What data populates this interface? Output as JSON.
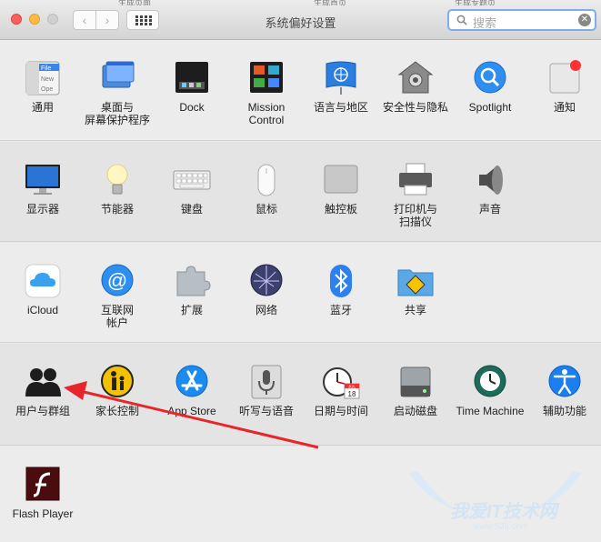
{
  "window": {
    "title": "系统偏好设置",
    "nav_back": "‹",
    "nav_forward": "›",
    "bg_tabs": [
      "生成页面",
      "生成首页",
      "生成专题页"
    ]
  },
  "search": {
    "placeholder": "搜索",
    "clear": "✕"
  },
  "rows": [
    [
      {
        "label": "通用",
        "icon": "general-icon"
      },
      {
        "label": "桌面与\n屏幕保护程序",
        "icon": "desktop-screensaver-icon"
      },
      {
        "label": "Dock",
        "icon": "dock-icon"
      },
      {
        "label": "Mission\nControl",
        "icon": "mission-control-icon"
      },
      {
        "label": "语言与地区",
        "icon": "language-region-icon"
      },
      {
        "label": "安全性与隐私",
        "icon": "security-privacy-icon"
      },
      {
        "label": "Spotlight",
        "icon": "spotlight-icon"
      },
      {
        "label": "通知",
        "icon": "notifications-icon"
      }
    ],
    [
      {
        "label": "显示器",
        "icon": "displays-icon"
      },
      {
        "label": "节能器",
        "icon": "energy-saver-icon"
      },
      {
        "label": "键盘",
        "icon": "keyboard-icon"
      },
      {
        "label": "鼠标",
        "icon": "mouse-icon"
      },
      {
        "label": "触控板",
        "icon": "trackpad-icon"
      },
      {
        "label": "打印机与\n扫描仪",
        "icon": "printer-icon"
      },
      {
        "label": "声音",
        "icon": "sound-icon"
      }
    ],
    [
      {
        "label": "iCloud",
        "icon": "icloud-icon"
      },
      {
        "label": "互联网\n帐户",
        "icon": "internet-accounts-icon"
      },
      {
        "label": "扩展",
        "icon": "extensions-icon"
      },
      {
        "label": "网络",
        "icon": "network-icon"
      },
      {
        "label": "蓝牙",
        "icon": "bluetooth-icon"
      },
      {
        "label": "共享",
        "icon": "sharing-icon"
      }
    ],
    [
      {
        "label": "用户与群组",
        "icon": "users-groups-icon"
      },
      {
        "label": "家长控制",
        "icon": "parental-controls-icon"
      },
      {
        "label": "App Store",
        "icon": "app-store-icon"
      },
      {
        "label": "听写与语音",
        "icon": "dictation-speech-icon"
      },
      {
        "label": "日期与时间",
        "icon": "date-time-icon"
      },
      {
        "label": "启动磁盘",
        "icon": "startup-disk-icon"
      },
      {
        "label": "Time Machine",
        "icon": "time-machine-icon"
      },
      {
        "label": "辅助功能",
        "icon": "accessibility-icon"
      }
    ],
    [
      {
        "label": "Flash Player",
        "icon": "flash-player-icon"
      }
    ]
  ],
  "icon_text": {
    "file": "File",
    "new": "New",
    "ope": "Ope",
    "cal_month": "JUL",
    "cal_day": "18"
  },
  "watermark": {
    "text": "我爱IT技术网",
    "url": "www.52ij.com"
  },
  "colors": {
    "close": "#fc605c",
    "minimize": "#fdbc40",
    "zoom_disabled": "#d0d0d0",
    "arrow": "#e8262a",
    "search_focus": "#7fadea"
  }
}
